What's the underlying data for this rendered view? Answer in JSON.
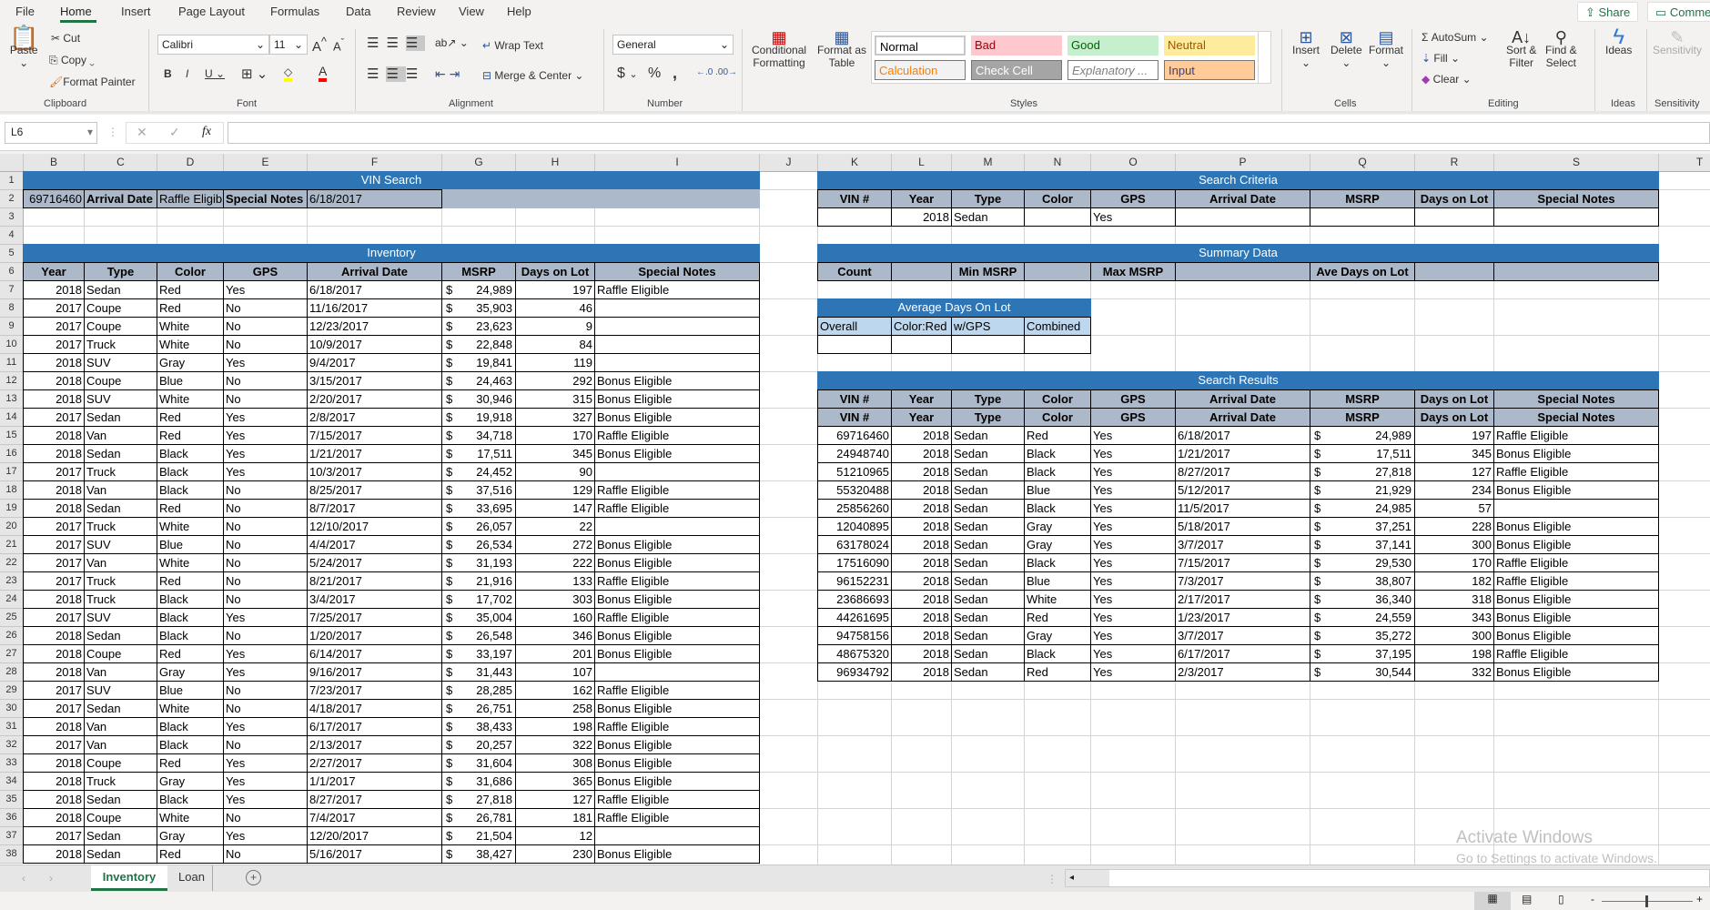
{
  "menu": {
    "tabs": [
      "File",
      "Home",
      "Insert",
      "Page Layout",
      "Formulas",
      "Data",
      "Review",
      "View",
      "Help"
    ],
    "active": "Home",
    "share": "Share",
    "comments": "Comments"
  },
  "ribbon": {
    "clipboard": {
      "paste": "Paste",
      "cut": "Cut",
      "copy": "Copy",
      "format_painter": "Format Painter",
      "label": "Clipboard"
    },
    "font": {
      "name": "Calibri",
      "size": "11",
      "label": "Font"
    },
    "alignment": {
      "wrap": "Wrap Text",
      "merge": "Merge & Center",
      "label": "Alignment"
    },
    "number": {
      "format": "General",
      "label": "Number"
    },
    "styles": {
      "conditional": "Conditional",
      "conditional2": "Formatting",
      "format_table": "Format as",
      "format_table2": "Table",
      "label": "Styles",
      "gallery": [
        {
          "name": "Normal",
          "bg": "#ffffff",
          "fg": "#000000"
        },
        {
          "name": "Bad",
          "bg": "#ffc7ce",
          "fg": "#9c0006"
        },
        {
          "name": "Good",
          "bg": "#c6efce",
          "fg": "#006100"
        },
        {
          "name": "Neutral",
          "bg": "#ffeb9c",
          "fg": "#9c5700"
        },
        {
          "name": "Calculation",
          "bg": "#f2f2f2",
          "fg": "#fa7d00"
        },
        {
          "name": "Check Cell",
          "bg": "#a5a5a5",
          "fg": "#ffffff"
        },
        {
          "name": "Explanatory ...",
          "bg": "#ffffff",
          "fg": "#7f7f7f"
        },
        {
          "name": "Input",
          "bg": "#ffcc99",
          "fg": "#3f3f76"
        }
      ]
    },
    "cells": {
      "insert": "Insert",
      "delete": "Delete",
      "format": "Format",
      "label": "Cells"
    },
    "editing": {
      "autosum": "AutoSum",
      "fill": "Fill",
      "clear": "Clear",
      "sort": "Sort &",
      "sort2": "Filter",
      "find": "Find &",
      "find2": "Select",
      "label": "Editing"
    },
    "ideas": {
      "button": "Ideas",
      "label": "Ideas"
    },
    "sensitivity": {
      "button": "Sensitivity",
      "label": "Sensitivity"
    }
  },
  "formula_bar": {
    "name_box": "L6",
    "content": ""
  },
  "columns": [
    "B",
    "C",
    "D",
    "E",
    "F",
    "G",
    "H",
    "I",
    "J",
    "K",
    "L",
    "M",
    "N",
    "O",
    "P",
    "Q",
    "R",
    "S",
    "T"
  ],
  "row_numbers": [
    1,
    2,
    3,
    4,
    5,
    6,
    7,
    8,
    9,
    10,
    11,
    12,
    13,
    14,
    15,
    16,
    17,
    18,
    19,
    20,
    21,
    22,
    23,
    24,
    25,
    26,
    27,
    28,
    29,
    30,
    31,
    32,
    33,
    34,
    35,
    36,
    37,
    38
  ],
  "currency": "$",
  "vin_search": {
    "title": "VIN Search",
    "vin": "69716460",
    "field1": "Arrival Date",
    "value1": "Raffle Eligible",
    "field2": "Special Notes",
    "value2": "6/18/2017"
  },
  "inventory": {
    "title": "Inventory",
    "headers": [
      "Year",
      "Type",
      "Color",
      "GPS",
      "Arrival Date",
      "MSRP",
      "Days on Lot",
      "Special Notes"
    ],
    "rows": [
      [
        "2018",
        "Sedan",
        "Red",
        "Yes",
        "6/18/2017",
        "24,989",
        "197",
        "Raffle Eligible"
      ],
      [
        "2017",
        "Coupe",
        "Red",
        "No",
        "11/16/2017",
        "35,903",
        "46",
        ""
      ],
      [
        "2017",
        "Coupe",
        "White",
        "No",
        "12/23/2017",
        "23,623",
        "9",
        ""
      ],
      [
        "2017",
        "Truck",
        "White",
        "No",
        "10/9/2017",
        "22,848",
        "84",
        ""
      ],
      [
        "2018",
        "SUV",
        "Gray",
        "Yes",
        "9/4/2017",
        "19,841",
        "119",
        ""
      ],
      [
        "2018",
        "Coupe",
        "Blue",
        "No",
        "3/15/2017",
        "24,463",
        "292",
        "Bonus Eligible"
      ],
      [
        "2018",
        "SUV",
        "White",
        "No",
        "2/20/2017",
        "30,946",
        "315",
        "Bonus Eligible"
      ],
      [
        "2017",
        "Sedan",
        "Red",
        "Yes",
        "2/8/2017",
        "19,918",
        "327",
        "Bonus Eligible"
      ],
      [
        "2018",
        "Van",
        "Red",
        "Yes",
        "7/15/2017",
        "34,718",
        "170",
        "Raffle Eligible"
      ],
      [
        "2018",
        "Sedan",
        "Black",
        "Yes",
        "1/21/2017",
        "17,511",
        "345",
        "Bonus Eligible"
      ],
      [
        "2017",
        "Truck",
        "Black",
        "Yes",
        "10/3/2017",
        "24,452",
        "90",
        ""
      ],
      [
        "2018",
        "Van",
        "Black",
        "No",
        "8/25/2017",
        "37,516",
        "129",
        "Raffle Eligible"
      ],
      [
        "2018",
        "Sedan",
        "Red",
        "No",
        "8/7/2017",
        "33,695",
        "147",
        "Raffle Eligible"
      ],
      [
        "2017",
        "Truck",
        "White",
        "No",
        "12/10/2017",
        "26,057",
        "22",
        ""
      ],
      [
        "2017",
        "SUV",
        "Blue",
        "No",
        "4/4/2017",
        "26,534",
        "272",
        "Bonus Eligible"
      ],
      [
        "2017",
        "Van",
        "White",
        "No",
        "5/24/2017",
        "31,193",
        "222",
        "Bonus Eligible"
      ],
      [
        "2017",
        "Truck",
        "Red",
        "No",
        "8/21/2017",
        "21,916",
        "133",
        "Raffle Eligible"
      ],
      [
        "2018",
        "Truck",
        "Black",
        "No",
        "3/4/2017",
        "17,702",
        "303",
        "Bonus Eligible"
      ],
      [
        "2017",
        "SUV",
        "Black",
        "Yes",
        "7/25/2017",
        "35,004",
        "160",
        "Raffle Eligible"
      ],
      [
        "2018",
        "Sedan",
        "Black",
        "No",
        "1/20/2017",
        "26,548",
        "346",
        "Bonus Eligible"
      ],
      [
        "2018",
        "Coupe",
        "Red",
        "Yes",
        "6/14/2017",
        "33,197",
        "201",
        "Bonus Eligible"
      ],
      [
        "2018",
        "Van",
        "Gray",
        "Yes",
        "9/16/2017",
        "31,443",
        "107",
        ""
      ],
      [
        "2017",
        "SUV",
        "Blue",
        "No",
        "7/23/2017",
        "28,285",
        "162",
        "Raffle Eligible"
      ],
      [
        "2017",
        "Sedan",
        "White",
        "No",
        "4/18/2017",
        "26,751",
        "258",
        "Bonus Eligible"
      ],
      [
        "2018",
        "Van",
        "Black",
        "Yes",
        "6/17/2017",
        "38,433",
        "198",
        "Raffle Eligible"
      ],
      [
        "2017",
        "Van",
        "Black",
        "No",
        "2/13/2017",
        "20,257",
        "322",
        "Bonus Eligible"
      ],
      [
        "2018",
        "Coupe",
        "Red",
        "Yes",
        "2/27/2017",
        "31,604",
        "308",
        "Bonus Eligible"
      ],
      [
        "2018",
        "Truck",
        "Gray",
        "Yes",
        "1/1/2017",
        "31,686",
        "365",
        "Bonus Eligible"
      ],
      [
        "2018",
        "Sedan",
        "Black",
        "Yes",
        "8/27/2017",
        "27,818",
        "127",
        "Raffle Eligible"
      ],
      [
        "2018",
        "Coupe",
        "White",
        "No",
        "7/4/2017",
        "26,781",
        "181",
        "Raffle Eligible"
      ],
      [
        "2017",
        "Sedan",
        "Gray",
        "Yes",
        "12/20/2017",
        "21,504",
        "12",
        ""
      ],
      [
        "2018",
        "Sedan",
        "Red",
        "No",
        "5/16/2017",
        "38,427",
        "230",
        "Bonus Eligible"
      ]
    ]
  },
  "search_criteria": {
    "title": "Search Criteria",
    "headers": [
      "VIN #",
      "Year",
      "Type",
      "Color",
      "GPS",
      "Arrival Date",
      "MSRP",
      "Days on Lot",
      "Special Notes"
    ],
    "values": [
      "",
      "2018",
      "Sedan",
      "",
      "Yes",
      "",
      "",
      "",
      ""
    ]
  },
  "summary": {
    "title": "Summary Data",
    "labels": [
      "Count",
      "",
      "Min MSRP",
      "",
      "Max MSRP",
      "",
      "Ave Days on Lot",
      "",
      ""
    ]
  },
  "avg_days": {
    "title": "Average Days On Lot",
    "headers": [
      "Overall",
      "Color:Red",
      "w/GPS",
      "Combined"
    ]
  },
  "search_results": {
    "title": "Search Results",
    "headers": [
      "VIN #",
      "Year",
      "Type",
      "Color",
      "GPS",
      "Arrival Date",
      "MSRP",
      "Days on Lot",
      "Special Notes"
    ],
    "rows": [
      [
        "69716460",
        "2018",
        "Sedan",
        "Red",
        "Yes",
        "6/18/2017",
        "24,989",
        "197",
        "Raffle Eligible"
      ],
      [
        "24948740",
        "2018",
        "Sedan",
        "Black",
        "Yes",
        "1/21/2017",
        "17,511",
        "345",
        "Bonus Eligible"
      ],
      [
        "51210965",
        "2018",
        "Sedan",
        "Black",
        "Yes",
        "8/27/2017",
        "27,818",
        "127",
        "Raffle Eligible"
      ],
      [
        "55320488",
        "2018",
        "Sedan",
        "Blue",
        "Yes",
        "5/12/2017",
        "21,929",
        "234",
        "Bonus Eligible"
      ],
      [
        "25856260",
        "2018",
        "Sedan",
        "Black",
        "Yes",
        "11/5/2017",
        "24,985",
        "57",
        ""
      ],
      [
        "12040895",
        "2018",
        "Sedan",
        "Gray",
        "Yes",
        "5/18/2017",
        "37,251",
        "228",
        "Bonus Eligible"
      ],
      [
        "63178024",
        "2018",
        "Sedan",
        "Gray",
        "Yes",
        "3/7/2017",
        "37,141",
        "300",
        "Bonus Eligible"
      ],
      [
        "17516090",
        "2018",
        "Sedan",
        "Black",
        "Yes",
        "7/15/2017",
        "29,530",
        "170",
        "Raffle Eligible"
      ],
      [
        "96152231",
        "2018",
        "Sedan",
        "Blue",
        "Yes",
        "7/3/2017",
        "38,807",
        "182",
        "Raffle Eligible"
      ],
      [
        "23686693",
        "2018",
        "Sedan",
        "White",
        "Yes",
        "2/17/2017",
        "36,340",
        "318",
        "Bonus Eligible"
      ],
      [
        "44261695",
        "2018",
        "Sedan",
        "Red",
        "Yes",
        "1/23/2017",
        "24,559",
        "343",
        "Bonus Eligible"
      ],
      [
        "94758156",
        "2018",
        "Sedan",
        "Gray",
        "Yes",
        "3/7/2017",
        "35,272",
        "300",
        "Bonus Eligible"
      ],
      [
        "48675320",
        "2018",
        "Sedan",
        "Black",
        "Yes",
        "6/17/2017",
        "37,195",
        "198",
        "Raffle Eligible"
      ],
      [
        "96934792",
        "2018",
        "Sedan",
        "Red",
        "Yes",
        "2/3/2017",
        "30,544",
        "332",
        "Bonus Eligible"
      ]
    ]
  },
  "sheet_tabs": {
    "tabs": [
      "Inventory",
      "Loan"
    ],
    "active": "Inventory"
  },
  "watermark": {
    "title": "Activate Windows",
    "subtitle": "Go to Settings to activate Windows."
  },
  "colors": {
    "header_blue": "#2e75b6",
    "header_gray": "#acb9ca",
    "light_blue": "#bdd7ee",
    "excel_green": "#217346"
  }
}
